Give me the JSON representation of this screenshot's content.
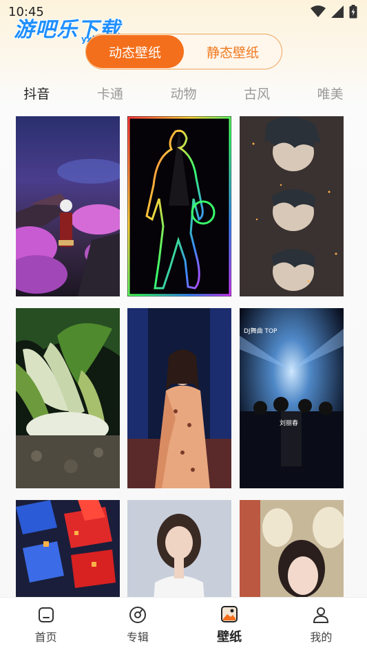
{
  "status_bar": {
    "time": "10:45"
  },
  "watermark": {
    "text": "游吧乐下载",
    "sub": "yxbl.com"
  },
  "mode_toggle": [
    {
      "label": "动态壁纸",
      "active": true
    },
    {
      "label": "静态壁纸",
      "active": false
    }
  ],
  "tabs": [
    {
      "label": "抖音",
      "active": true
    },
    {
      "label": "卡通",
      "active": false
    },
    {
      "label": "动物",
      "active": false
    },
    {
      "label": "古风",
      "active": false
    },
    {
      "label": "唯美",
      "active": false
    }
  ],
  "wallpapers": [
    {
      "id": "anime-sakura-warrior",
      "texts": []
    },
    {
      "id": "neon-basketball-player",
      "texts": []
    },
    {
      "id": "anime-boy-repeated",
      "texts": []
    },
    {
      "id": "bok-choy-vegetable",
      "texts": []
    },
    {
      "id": "woman-qipao-stage",
      "texts": []
    },
    {
      "id": "nightclub-dj",
      "texts": [
        "DJ舞曲 TOP",
        "刘丽春"
      ]
    },
    {
      "id": "red-blue-cubes",
      "texts": []
    },
    {
      "id": "woman-white-dress",
      "texts": []
    },
    {
      "id": "woman-hanfu-lanterns",
      "texts": []
    }
  ],
  "bottom_nav": [
    {
      "label": "首页",
      "icon": "home-icon",
      "active": false
    },
    {
      "label": "专辑",
      "icon": "disc-icon",
      "active": false
    },
    {
      "label": "壁纸",
      "icon": "image-icon",
      "active": true
    },
    {
      "label": "我的",
      "icon": "user-icon",
      "active": false
    }
  ]
}
